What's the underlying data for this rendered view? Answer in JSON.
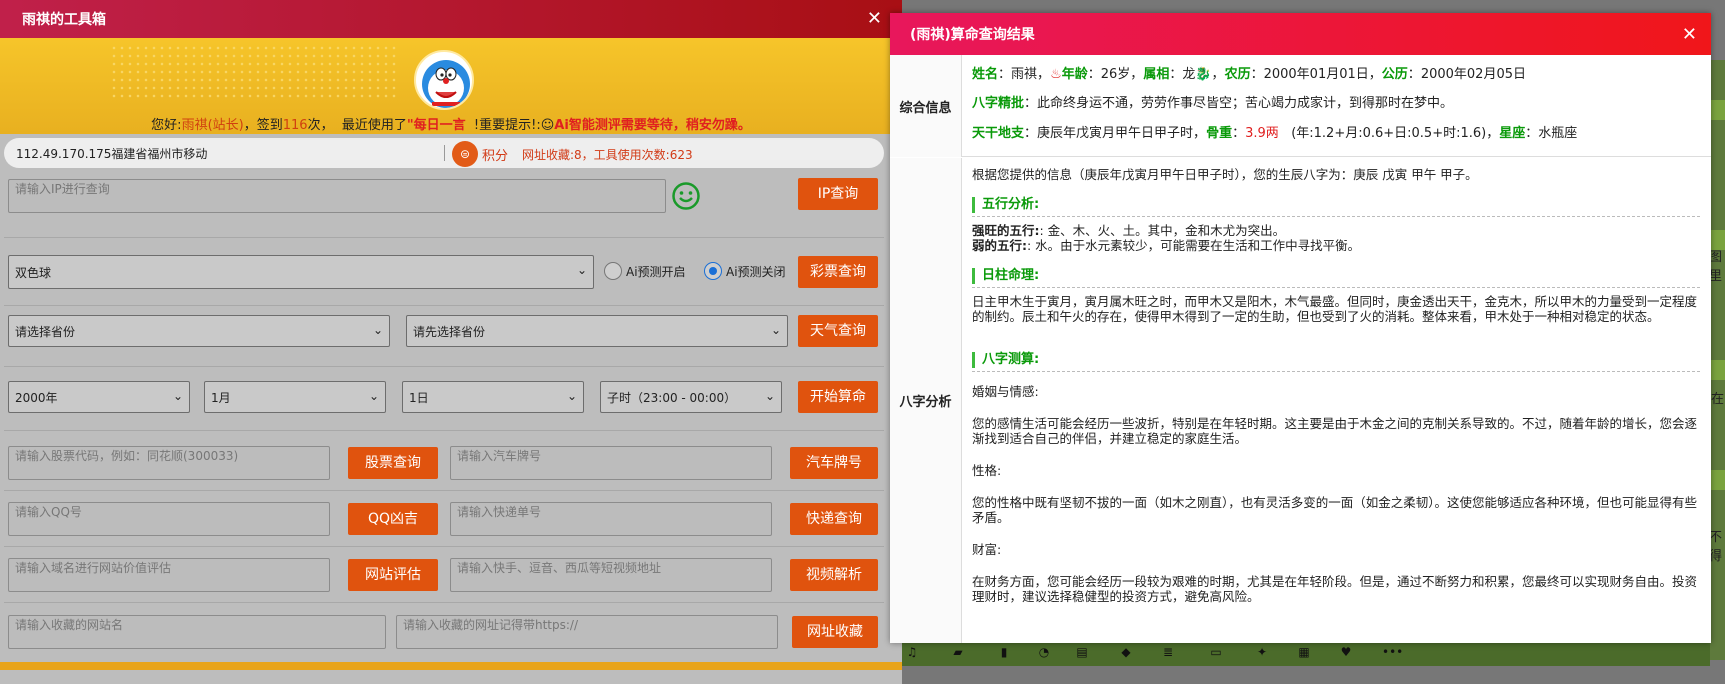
{
  "toolbox": {
    "title": "雨祺的工具箱",
    "greeting": {
      "prefix": "您好:",
      "user": "雨祺",
      "role": "(站长)",
      "signin": "，签到",
      "days": "116",
      "days_suffix": "次，",
      "recent": "最近使用了",
      "recent_item": "\"每日一言",
      "notice": "!重要提示!:",
      "notice_text": "Ai智能测评需要等待，稍安勿躁。"
    },
    "ip_location": "112.49.170.175福建省福州市移动",
    "score_label": "积分",
    "fav_stats": "网址收藏:8，工具使用次数:623",
    "ip_placeholder": "请输入IP进行查询",
    "ip_button": "IP查询",
    "lottery_selected": "双色球",
    "ai_on": "Ai预测开启",
    "ai_off": "Ai预测关闭",
    "lottery_button": "彩票查询",
    "province_select": "请选择省份",
    "city_select": "请先选择省份",
    "weather_button": "天气查询",
    "year_select": "2000年",
    "month_select": "1月",
    "day_select": "1日",
    "hour_select": "子时（23:00 - 00:00）",
    "fortune_button": "开始算命",
    "stock_placeholder": "请输入股票代码，例如：同花顺(300033)",
    "stock_button": "股票查询",
    "plate_placeholder": "请输入汽车牌号",
    "plate_button": "汽车牌号",
    "qq_placeholder": "请输入QQ号",
    "qq_button": "QQ凶吉",
    "express_placeholder": "请输入快递单号",
    "express_button": "快递查询",
    "domain_placeholder": "请输入域名进行网站价值评估",
    "domain_button": "网站评估",
    "video_placeholder": "请输入快手、逗音、西瓜等短视频地址",
    "video_button": "视频解析",
    "site_name_placeholder": "请输入收藏的网站名",
    "site_url_placeholder": "请输入收藏的网址记得带https://",
    "collect_button": "网址收藏"
  },
  "modal": {
    "title": "(雨祺)算命查询结果",
    "summary_label": "综合信息",
    "analysis_label": "八字分析",
    "name_key": "姓名",
    "name_val": "雨祺",
    "age_key": "年龄",
    "age_val": "26岁",
    "zodiac_key": "属相",
    "zodiac_val": "龙",
    "lunar_key": "农历",
    "lunar_val": "2000年01月01日",
    "solar_key": "公历",
    "solar_val": "2000年02月05日",
    "bazi_key": "八字精批",
    "bazi_val": "此命终身运不通，劳劳作事尽皆空；苦心竭力成家计，到得那时在梦中。",
    "tiandi_key": "天干地支",
    "tiandi_val": "庚辰年戊寅月甲午日甲子时",
    "weight_key": "骨重",
    "weight_val": "3.9两",
    "weight_detail": "(年:1.2+月:0.6+日:0.5+时:1.6)",
    "star_key": "星座",
    "star_val": "水瓶座",
    "intro": "根据您提供的信息（庚辰年戊寅月甲午日甲子时），您的生辰八字为：庚辰 戊寅 甲午 甲子。",
    "wuxing_title": "五行分析:",
    "strong_label": "强旺的五行:",
    "strong_text": ": 金、木、火、土。其中，金和木尤为突出。",
    "weak_label": "弱的五行:",
    "weak_text": ": 水。由于水元素较少，可能需要在生活和工作中寻找平衡。",
    "rizhu_title": "日柱命理:",
    "rizhu_text": "日主甲木生于寅月，寅月属木旺之时，而甲木又是阳木，木气最盛。但同时，庚金透出天干，金克木，所以甲木的力量受到一定程度的制约。辰土和午火的存在，使得甲木得到了一定的生助，但也受到了火的消耗。整体来看，甲木处于一种相对稳定的状态。",
    "cesuan_title": "八字测算:",
    "marriage_label": "婚姻与情感:",
    "marriage_text": "您的感情生活可能会经历一些波折，特别是在年轻时期。这主要是由于木金之间的克制关系导致的。不过，随着年龄的增长，您会逐渐找到适合自己的伴侣，并建立稳定的家庭生活。",
    "character_label": "性格:",
    "character_text": "您的性格中既有坚韧不拔的一面（如木之刚直），也有灵活多变的一面（如金之柔韧）。这使您能够适应各种环境，但也可能显得有些矛盾。",
    "wealth_label": "财富:",
    "wealth_text": "在财务方面，您可能会经历一段较为艰难的时期，尤其是在年轻阶段。但是，通过不断努力和积累，您最终可以实现财务自由。投资理财时，建议选择稳健型的投资方式，避免高风险。"
  },
  "background": {
    "side_text_1": "图里",
    "side_text_2": "在",
    "side_text_3": "不得"
  }
}
